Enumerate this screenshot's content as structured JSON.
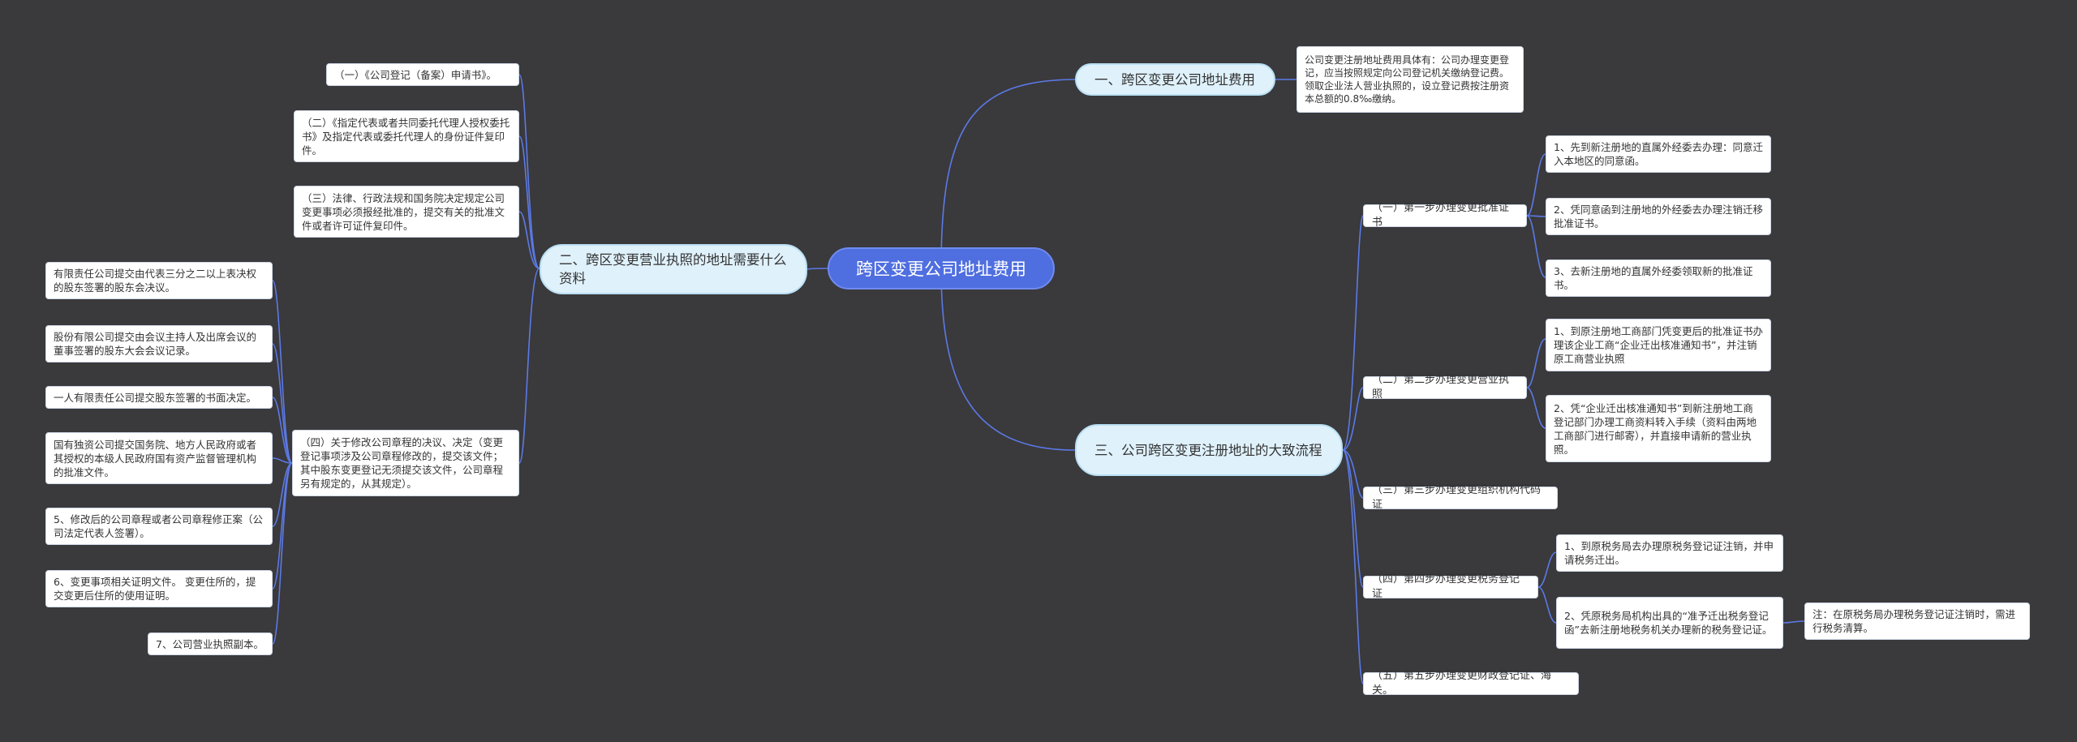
{
  "root": "跨区变更公司地址费用",
  "branch1": {
    "label": "一、跨区变更公司地址费用",
    "note": "公司变更注册地址费用具体有：公司办理变更登记，应当按照规定向公司登记机关缴纳登记费。领取企业法人营业执照的，设立登记费按注册资本总额的0.8‰缴纳。"
  },
  "branch2": {
    "label": "二、跨区变更营业执照的地址需要什么资料",
    "items": [
      "（一）《公司登记（备案）申请书》。",
      "（二）《指定代表或者共同委托代理人授权委托书》及指定代表或委托代理人的身份证件复印件。",
      "（三）法律、行政法规和国务院决定规定公司变更事项必须报经批准的，提交有关的批准文件或者许可证件复印件。",
      "（四）关于修改公司章程的决议、决定（变更登记事项涉及公司章程修改的，提交该文件；其中股东变更登记无须提交该文件，公司章程另有规定的，从其规定）。"
    ],
    "sub4": [
      "有限责任公司提交由代表三分之二以上表决权的股东签署的股东会决议。",
      "股份有限公司提交由会议主持人及出席会议的董事签署的股东大会会议记录。",
      "一人有限责任公司提交股东签署的书面决定。",
      "国有独资公司提交国务院、地方人民政府或者其授权的本级人民政府国有资产监督管理机构的批准文件。",
      "5、修改后的公司章程或者公司章程修正案（公司法定代表人签署）。",
      "6、变更事项相关证明文件。 变更住所的，提交变更后住所的使用证明。",
      "7、公司营业执照副本。"
    ]
  },
  "branch3": {
    "label": "三、公司跨区变更注册地址的大致流程",
    "steps": [
      {
        "label": "（一）第一步办理变更批准证书",
        "children": [
          "1、先到新注册地的直属外经委去办理：同意迁入本地区的同意函。",
          "2、凭同意函到注册地的外经委去办理注销迁移批准证书。",
          "3、去新注册地的直属外经委领取新的批准证书。"
        ]
      },
      {
        "label": "（二）第二步办理变更营业执照",
        "children": [
          "1、到原注册地工商部门凭变更后的批准证书办理该企业工商“企业迁出核准通知书”，并注销原工商营业执照",
          "2、凭“企业迁出核准通知书”到新注册地工商登记部门办理工商资料转入手续（资料由两地工商部门进行邮寄），并直接申请新的营业执照。"
        ]
      },
      {
        "label": "（三）第三步办理变更组织机构代码证",
        "children": []
      },
      {
        "label": "（四）第四步办理变更税务登记证",
        "children": [
          "1、到原税务局去办理原税务登记证注销，并申请税务迁出。",
          "2、凭原税务局机构出具的“准予迁出税务登记函”去新注册地税务机关办理新的税务登记证。"
        ],
        "note": "注：在原税务局办理税务登记证注销时，需进行税务清算。"
      },
      {
        "label": "（五）第五步办理变更财政登记证、海关。",
        "children": []
      }
    ]
  }
}
